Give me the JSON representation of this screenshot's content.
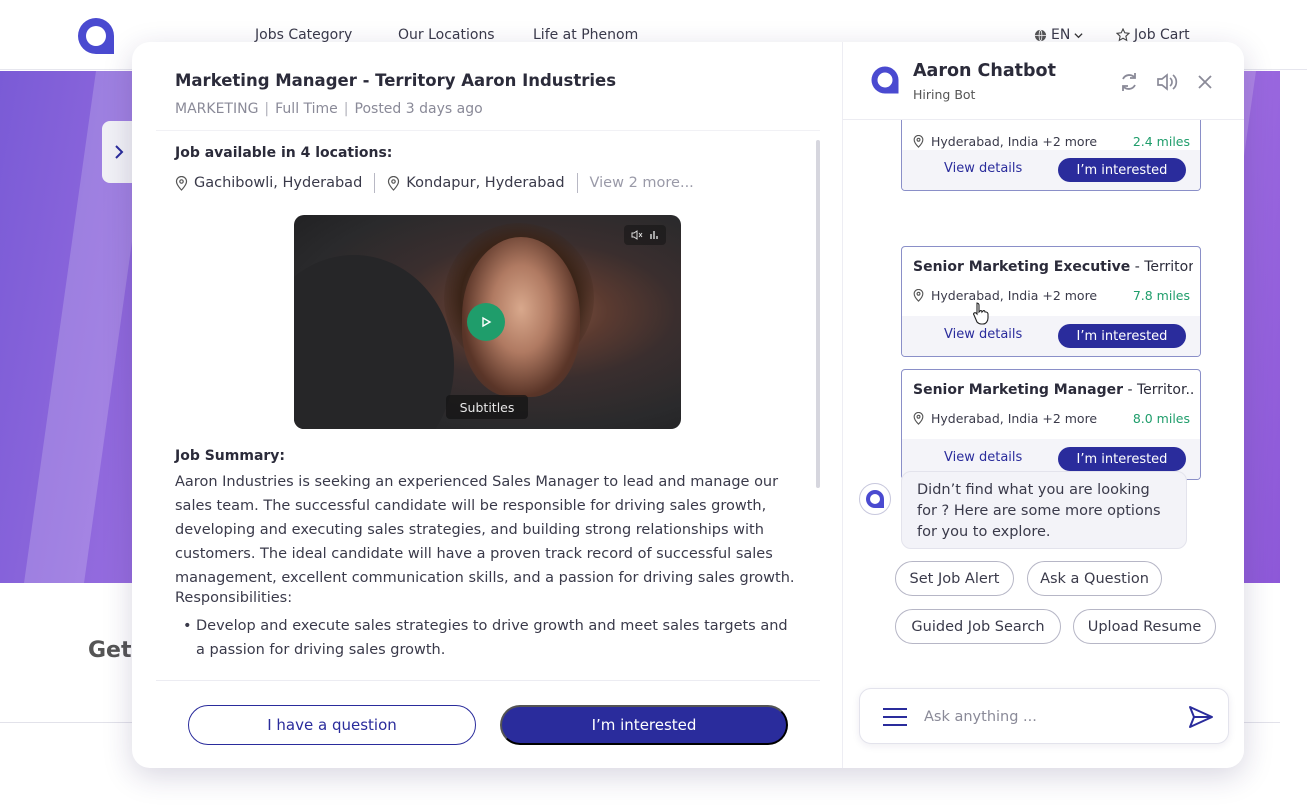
{
  "nav": {
    "links": [
      "Jobs Category",
      "Our Locations",
      "Life at Phenom"
    ],
    "language": "EN",
    "job_cart": "Job Cart"
  },
  "page": {
    "get_text": "Get"
  },
  "job": {
    "title": "Marketing Manager - Territory Aaron Industries",
    "meta": {
      "category": "MARKETING",
      "type": "Full Time",
      "posted": "Posted 3 days ago"
    },
    "locations_heading": "Job available in 4 locations:",
    "locations": [
      "Gachibowli, Hyderabad",
      "Kondapur, Hyderabad"
    ],
    "locations_more": "View 2 more...",
    "video": {
      "subtitles_label": "Subtitles"
    },
    "summary_heading": "Job Summary:",
    "summary_text": "Aaron Industries is seeking an experienced Sales Manager to lead and manage our sales team. The successful candidate will be responsible for driving sales growth, developing and executing sales strategies, and building strong relationships with customers. The ideal candidate will have a proven track record of successful sales management, excellent communication skills, and a passion for driving sales growth.",
    "responsibilities_heading": "Responsibilities:",
    "responsibilities": [
      "Develop and execute sales strategies to drive growth and meet sales targets and a passion for driving sales growth."
    ],
    "question_button": "I have a question",
    "interested_button": "I’m interested"
  },
  "chat": {
    "bot_name": "Aaron Chatbot",
    "bot_subtitle": "Hiring Bot",
    "cards": [
      {
        "title_bold": "",
        "title_rest": "",
        "location": "Hyderabad, India +2 more",
        "miles": "2.4 miles",
        "view": "View details",
        "interested": "I’m interested"
      },
      {
        "title_bold": "Senior Marketing Executive",
        "title_rest": " - Territor..",
        "location": "Hyderabad, India +2 more",
        "miles": "7.8 miles",
        "view": "View details",
        "interested": "I’m interested"
      },
      {
        "title_bold": "Senior Marketing Manager",
        "title_rest": " - Territor..",
        "location": "Hyderabad, India +2 more",
        "miles": "8.0 miles",
        "view": "View details",
        "interested": "I’m interested"
      }
    ],
    "bot_message": "Didn’t find what you are looking for ? Here are some more options for you to explore.",
    "chips": [
      "Set Job Alert",
      "Ask a Question",
      "Guided Job Search",
      "Upload Resume"
    ],
    "input_placeholder": "Ask anything ..."
  },
  "colors": {
    "primary": "#2a2c9c",
    "accent_green": "#1f9d6b",
    "logo": "#4a4ad0"
  }
}
